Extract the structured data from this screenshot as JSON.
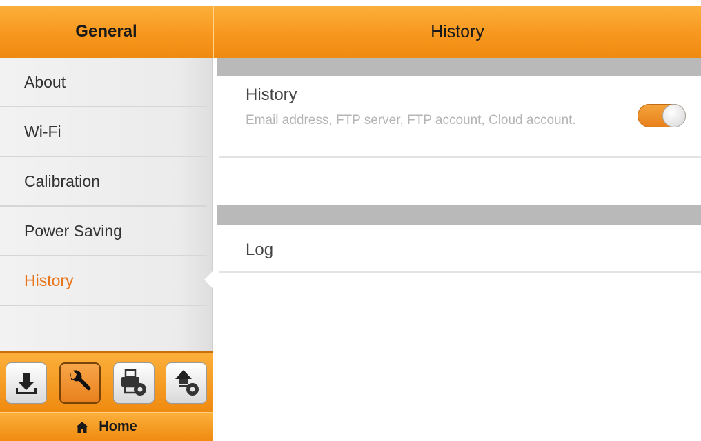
{
  "header": {
    "left_title": "General",
    "right_title": "History"
  },
  "sidebar": {
    "items": [
      {
        "label": "About"
      },
      {
        "label": "Wi-Fi"
      },
      {
        "label": "Calibration"
      },
      {
        "label": "Power Saving"
      },
      {
        "label": "History",
        "active": true
      }
    ]
  },
  "toolbar": {
    "buttons": [
      {
        "icon": "download-icon"
      },
      {
        "icon": "wrench-icon",
        "active": true
      },
      {
        "icon": "printer-settings-icon"
      },
      {
        "icon": "upload-settings-icon"
      }
    ],
    "home_label": "Home"
  },
  "content": {
    "history": {
      "title": "History",
      "description": "Email address, FTP server, FTP account, Cloud account.",
      "toggle_on": true
    },
    "log": {
      "title": "Log"
    }
  },
  "colors": {
    "accent": "#f7971e",
    "active_text": "#e8741c",
    "section_bar": "#b9b9b9"
  }
}
